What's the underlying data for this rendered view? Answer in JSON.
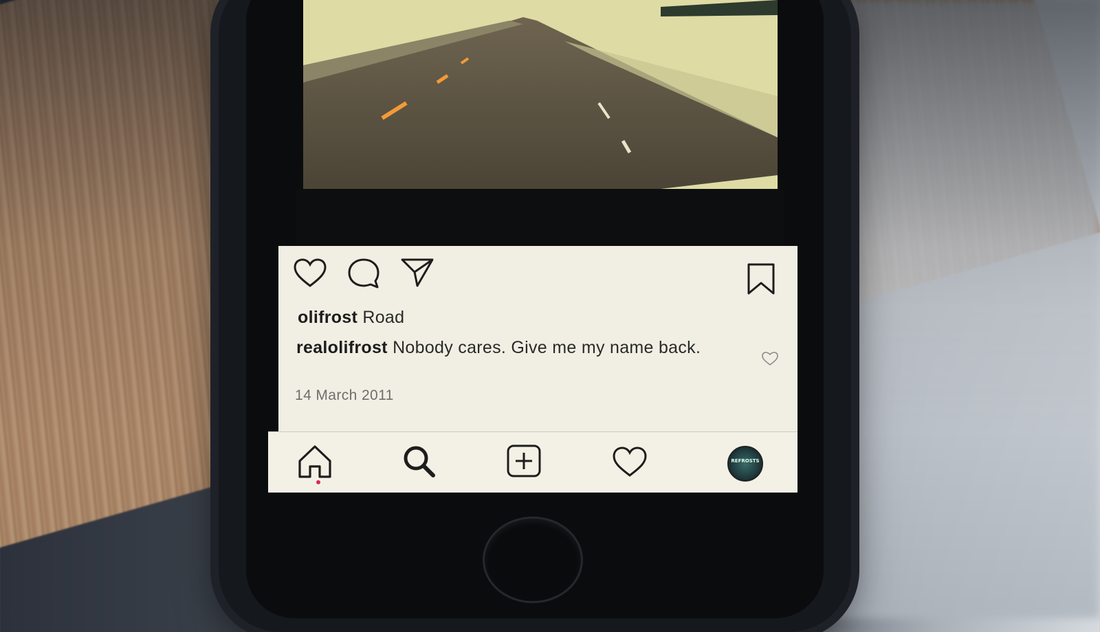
{
  "post": {
    "actions": {
      "like_icon": "heart-outline-icon",
      "comment_icon": "speech-bubble-icon",
      "share_icon": "paper-plane-icon",
      "save_icon": "bookmark-icon"
    },
    "author": "olifrost",
    "caption": "Road",
    "comment": {
      "user": "realolifrost",
      "text": "Nobody cares. Give me my name back.",
      "like_icon": "small-heart-icon"
    },
    "date": "14 March 2011"
  },
  "tabbar": {
    "items": [
      {
        "name": "home",
        "icon": "house-icon",
        "active": true
      },
      {
        "name": "search",
        "icon": "magnifier-icon"
      },
      {
        "name": "new-post",
        "icon": "plus-square-icon"
      },
      {
        "name": "activity",
        "icon": "heart-outline-icon"
      },
      {
        "name": "profile",
        "icon": "avatar-icon"
      }
    ],
    "avatar_text": "REFROSTS",
    "notification_dot_color": "#e0245e"
  },
  "colors": {
    "panel_bg": "#f1efe3",
    "text": "#1d1d1d",
    "date_text": "#6e6e6e",
    "phone_body": "#15181d"
  }
}
